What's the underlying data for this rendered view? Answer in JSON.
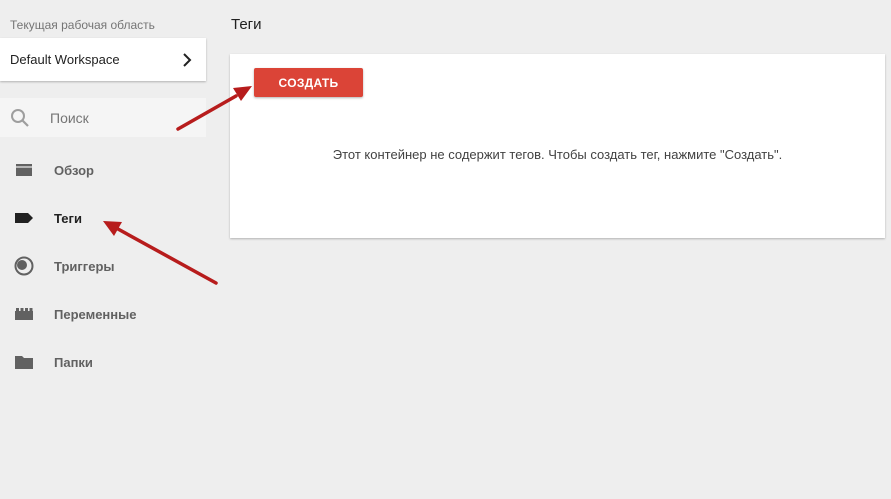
{
  "sidebar": {
    "workspace_label": "Текущая рабочая область",
    "workspace_name": "Default Workspace",
    "search_placeholder": "Поиск",
    "items": [
      {
        "label": "Обзор",
        "icon": "overview-icon"
      },
      {
        "label": "Теги",
        "icon": "tag-icon",
        "active": true
      },
      {
        "label": "Триггеры",
        "icon": "trigger-icon"
      },
      {
        "label": "Переменные",
        "icon": "variables-icon"
      },
      {
        "label": "Папки",
        "icon": "folder-icon"
      }
    ]
  },
  "main": {
    "title": "Теги",
    "create_label": "СОЗДАТЬ",
    "empty_message": "Этот контейнер не содержит тегов. Чтобы создать тег, нажмите \"Создать\"."
  },
  "colors": {
    "accent": "#db4437",
    "annotation": "#b71c1c",
    "background": "#eeeeee"
  }
}
